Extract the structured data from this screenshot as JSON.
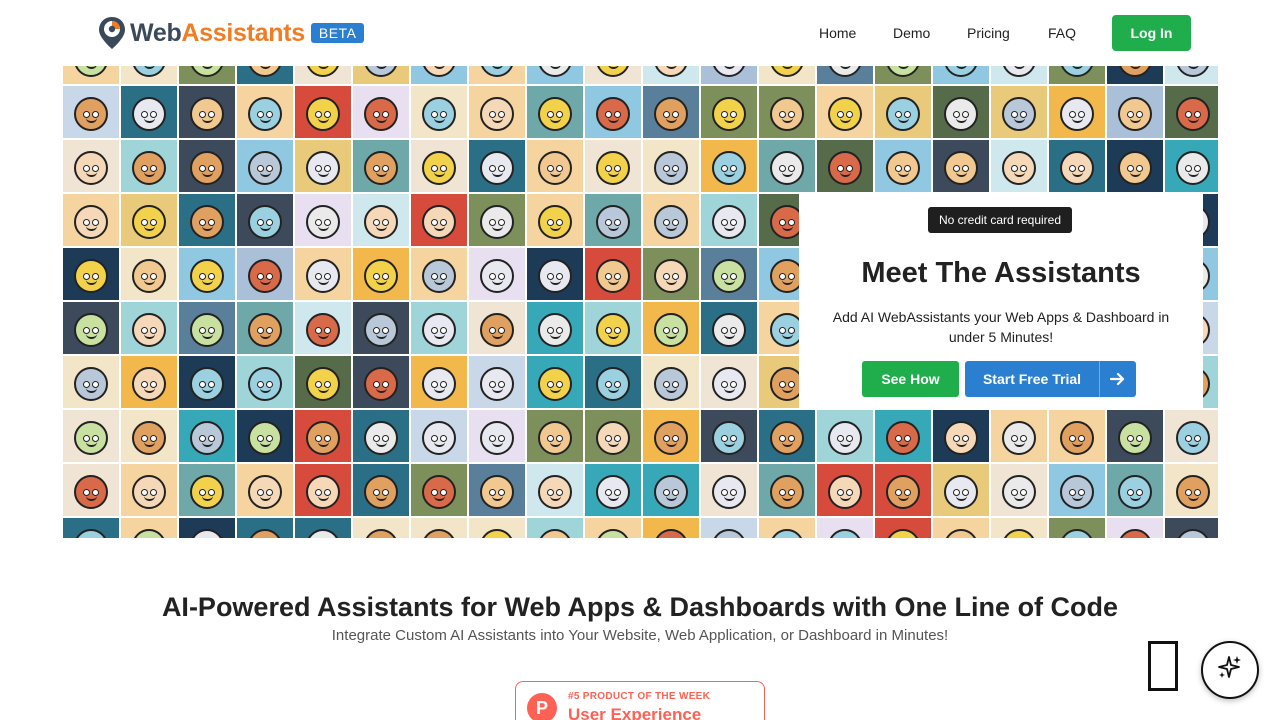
{
  "header": {
    "logo_part1": "Web",
    "logo_part2": "Assistants",
    "beta_label": "BETA",
    "nav": [
      {
        "label": "Home"
      },
      {
        "label": "Demo"
      },
      {
        "label": "Pricing"
      },
      {
        "label": "FAQ"
      }
    ],
    "login_label": "Log In"
  },
  "hero": {
    "badge": "No credit card required",
    "title": "Meet The Assistants",
    "description": "Add AI WebAssistants your Web Apps & Dashboard in under 5 Minutes!",
    "see_how_label": "See How",
    "trial_label": "Start Free Trial",
    "trial_icon": "arrow-right-icon"
  },
  "section": {
    "title": "AI-Powered Assistants for Web Apps & Dashboards with One Line of Code",
    "subtitle": "Integrate Custom AI Assistants into Your Website, Web Application, or Dashboard in Minutes!"
  },
  "product_hunt": {
    "logo_letter": "P",
    "rank": "#5 PRODUCT OF THE WEEK",
    "category": "User Experience"
  },
  "colors": {
    "brand_green": "#1fae4b",
    "brand_blue": "#2b7fd0",
    "brand_orange": "#f07c23",
    "product_hunt": "#ff6154"
  },
  "chat_fab_icon": "sparkle-icon"
}
